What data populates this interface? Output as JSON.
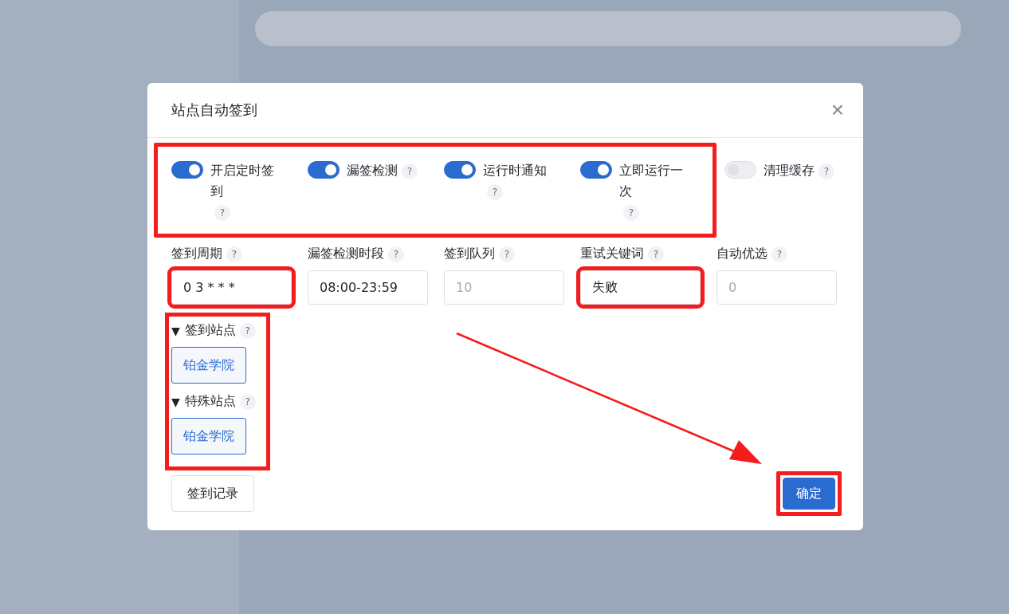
{
  "dialog": {
    "title": "站点自动签到",
    "close": "×",
    "switches": [
      {
        "label": "开启定时签到",
        "on": true,
        "help": "?",
        "highlighted": true
      },
      {
        "label": "漏签检测",
        "on": true,
        "help": "?",
        "highlighted": true
      },
      {
        "label": "运行时通知",
        "on": true,
        "help": "?",
        "highlighted": true
      },
      {
        "label": "立即运行一次",
        "on": true,
        "help": "?",
        "highlighted": true
      },
      {
        "label": "清理缓存",
        "on": false,
        "help": "?",
        "highlighted": false
      }
    ],
    "fields": [
      {
        "label": "签到周期",
        "help": "?",
        "value": "0 3 * * *",
        "highlighted": true
      },
      {
        "label": "漏签检测时段",
        "help": "?",
        "value": "08:00-23:59",
        "highlighted": false
      },
      {
        "label": "签到队列",
        "help": "?",
        "placeholder": "10",
        "highlighted": false
      },
      {
        "label": "重试关键词",
        "help": "?",
        "value": "失败",
        "highlighted": true
      },
      {
        "label": "自动优选",
        "help": "?",
        "placeholder": "0",
        "highlighted": false
      }
    ],
    "sections_highlighted": true,
    "sections": [
      {
        "toggle": "▼",
        "title": "签到站点",
        "help": "?",
        "expanded": true,
        "sites": [
          "铂金学院"
        ]
      },
      {
        "toggle": "▼",
        "title": "特殊站点",
        "help": "?",
        "expanded": true,
        "sites": [
          "铂金学院"
        ]
      }
    ],
    "footer": {
      "left_button": "签到记录",
      "confirm_button": "确定",
      "confirm_highlighted": true
    },
    "annotation_arrow": true
  }
}
